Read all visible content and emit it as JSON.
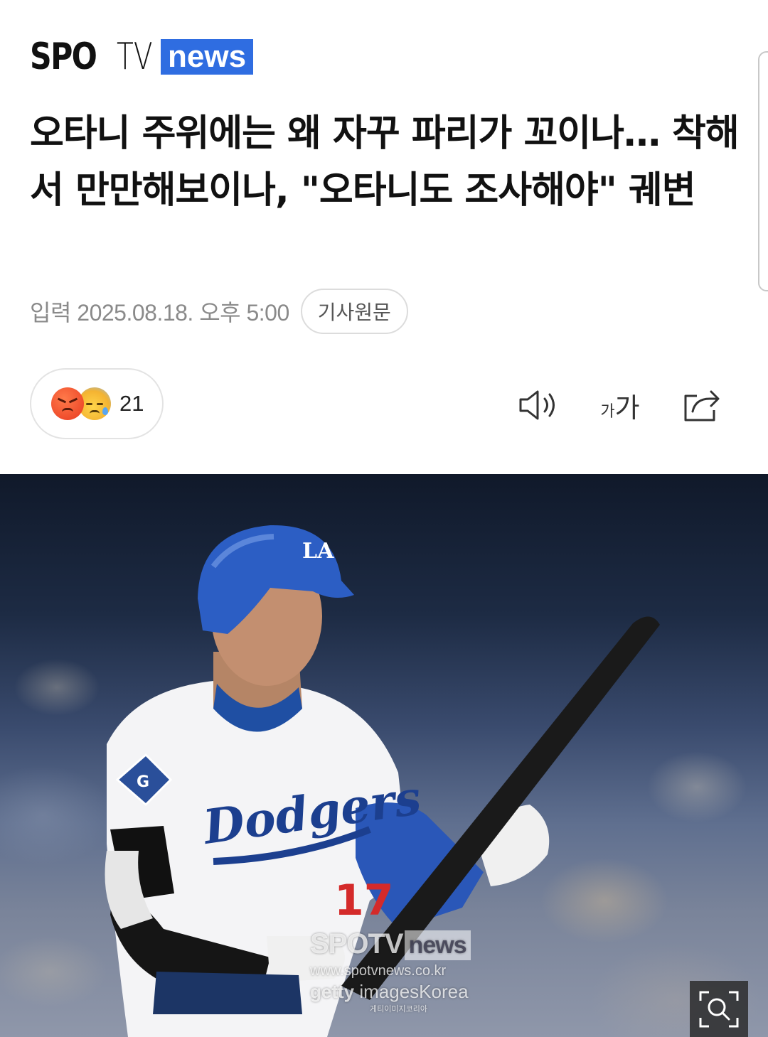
{
  "header": {
    "logo_primary": "SPO",
    "logo_secondary": "TV",
    "logo_badge": "news"
  },
  "article": {
    "headline": "오타니 주위에는 왜 자꾸 파리가 꼬이나… 착해서 만만해보이나, \"오타니도 조사해야\" 궤변",
    "date_line": "입력 2025.08.18. 오후 5:00",
    "origin_button": "기사원문"
  },
  "reactions": {
    "icons": [
      "angry-emoji",
      "sad-emoji"
    ],
    "count": "21"
  },
  "toolbar": {
    "icons": [
      "speaker-icon",
      "font-size-icon",
      "share-icon"
    ],
    "font_small": "가",
    "font_big": "가"
  },
  "photo": {
    "watermark_logo": "SPOTV",
    "watermark_logo_badge": "news",
    "watermark_url": "www.spotvnews.co.kr",
    "watermark_getty": "getty",
    "watermark_getty_rest": "imagesKorea",
    "watermark_getty_sub": "게티이미지코리아",
    "zoom_icon": "zoom-icon"
  },
  "colors": {
    "brand_blue": "#2f6de1",
    "meta_gray": "#8a8a8a"
  }
}
